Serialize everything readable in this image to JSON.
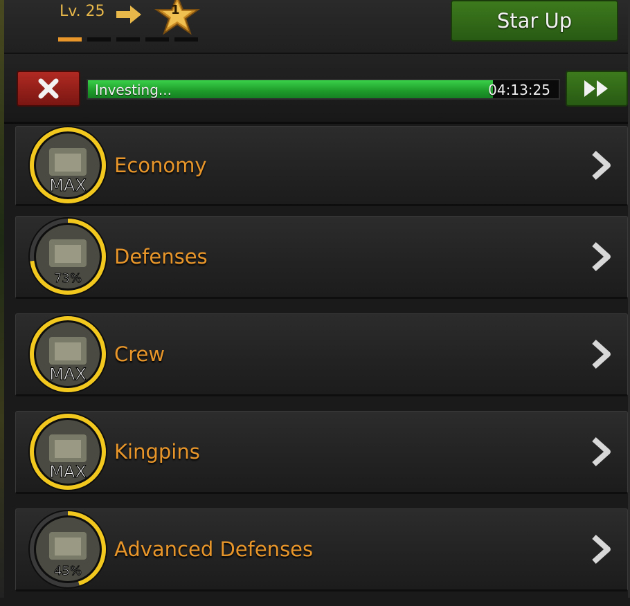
{
  "header": {
    "level": "Lv. 25",
    "star_level": "1",
    "dashes_filled": 1,
    "dashes_total": 5,
    "star_up_label": "Star Up"
  },
  "invest": {
    "label": "Investing...",
    "time": "04:13:25",
    "progress": 0.86
  },
  "categories": [
    {
      "label": "Economy",
      "badge": "MAX",
      "progress": 1.0,
      "icon": "money-stack-icon"
    },
    {
      "label": "Defenses",
      "badge": "73%",
      "progress": 0.73,
      "icon": "gate-icon"
    },
    {
      "label": "Crew",
      "badge": "MAX",
      "progress": 1.0,
      "icon": "crew-icon"
    },
    {
      "label": "Kingpins",
      "badge": "MAX",
      "progress": 1.0,
      "icon": "kingpins-icon"
    },
    {
      "label": "Advanced Defenses",
      "badge": "45%",
      "progress": 0.45,
      "icon": "advanced-gate-icon"
    }
  ],
  "colors": {
    "accent": "#e8962a",
    "ring": "#f2c81e",
    "progress_green": "#2bb83a"
  }
}
